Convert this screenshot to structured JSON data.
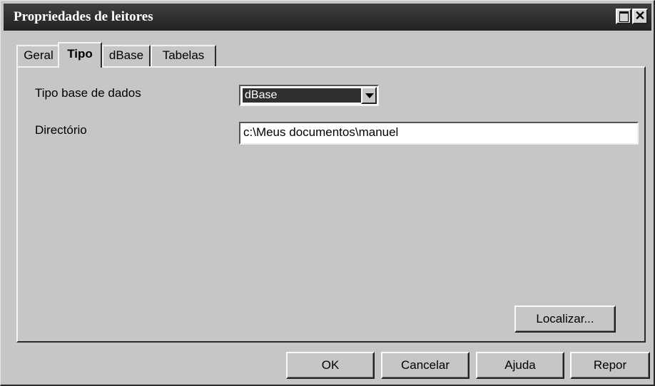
{
  "window": {
    "title": "Propriedades de leitores",
    "max_symbol": "",
    "close_symbol": "✕"
  },
  "tabs": [
    {
      "label": "Geral"
    },
    {
      "label": "Tipo"
    },
    {
      "label": "dBase"
    },
    {
      "label": "Tabelas"
    }
  ],
  "fields": {
    "db_type_label": "Tipo base de dados",
    "db_type_value": "dBase",
    "directory_label": "Directório",
    "directory_value": "c:\\Meus documentos\\manuel"
  },
  "buttons": {
    "localizar": "Localizar...",
    "ok": "OK",
    "cancel": "Cancelar",
    "help": "Ajuda",
    "reset": "Repor"
  },
  "icons": {
    "maximize": "maximize-icon",
    "close": "close-icon",
    "dropdown": "chevron-down-icon"
  }
}
